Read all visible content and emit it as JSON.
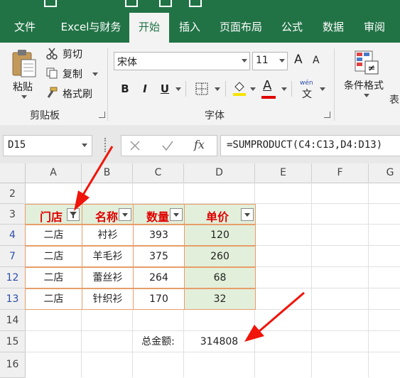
{
  "ribbon_tabs": [
    "文件",
    "Excel与财务",
    "开始",
    "插入",
    "页面布局",
    "公式",
    "数据",
    "审阅"
  ],
  "active_tab": "开始",
  "clipboard": {
    "paste": "粘贴",
    "cut": "剪切",
    "copy": "复制",
    "format_painter": "格式刷",
    "group_label": "剪贴板"
  },
  "font": {
    "name": "宋体",
    "size": "11",
    "grow_icon": "A",
    "shrink_icon": "A",
    "bold": "B",
    "italic": "I",
    "underline": "U",
    "font_color_icon": "A",
    "wen": "wén",
    "wen_char": "文",
    "group_label": "字体"
  },
  "styles": {
    "conditional_format": "条件格式",
    "partial_label": "表"
  },
  "formula_bar": {
    "name_box": "D15",
    "fx": "fx",
    "formula": "=SUMPRODUCT(C4:C13,D4:D13)"
  },
  "columns": [
    "A",
    "B",
    "C",
    "D",
    "E",
    "F",
    "G"
  ],
  "rows": [
    "2",
    "3",
    "4",
    "7",
    "12",
    "13",
    "14",
    "15",
    "16"
  ],
  "table": {
    "headers": [
      "门店",
      "名称",
      "数量",
      "单价"
    ],
    "data": [
      [
        "二店",
        "衬衫",
        "393",
        "120"
      ],
      [
        "二店",
        "羊毛衫",
        "375",
        "260"
      ],
      [
        "二店",
        "蕾丝衫",
        "264",
        "68"
      ],
      [
        "二店",
        "针织衫",
        "170",
        "32"
      ]
    ]
  },
  "total": {
    "label": "总金额:",
    "value": "314808"
  },
  "colors": {
    "excel_green": "#217346",
    "header_text": "#e00000",
    "table_fill": "#e2efda",
    "table_border": "#e69e6a",
    "arrow": "#f0140a"
  }
}
